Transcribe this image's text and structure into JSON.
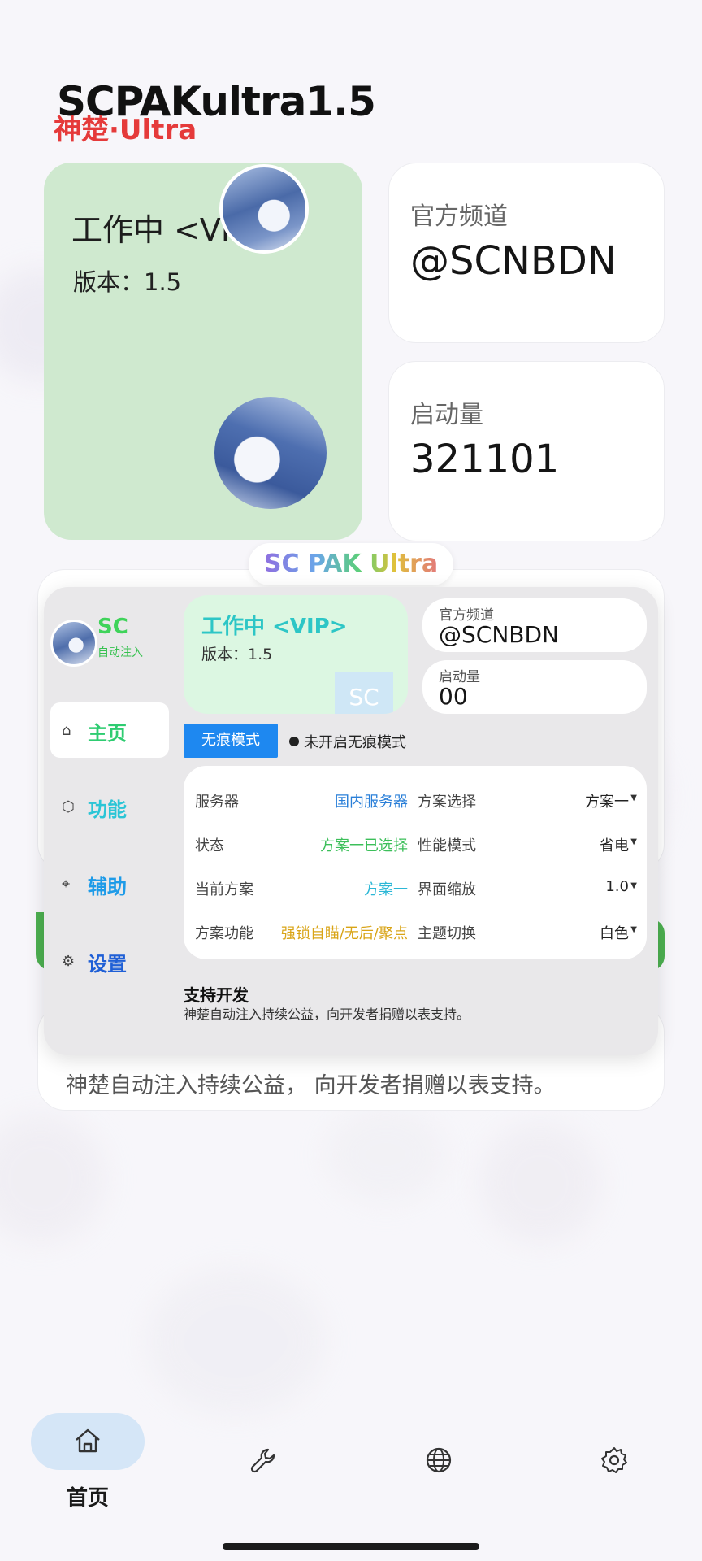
{
  "header": {
    "title": "SCPAKultra1.5",
    "subtitle": "神楚·Ultra"
  },
  "status_card": {
    "title": "工作中 <VIP>",
    "version": "版本：1.5"
  },
  "channel_card": {
    "label": "官方频道",
    "value": "@SCNBDN"
  },
  "launch_card": {
    "label": "启动量",
    "value": "321101"
  },
  "brand_pill": {
    "text": "SC PAK Ultra"
  },
  "support_card": {
    "text": "神楚自动注入持续公益， 向开发者捐赠以表支持。"
  },
  "overlay": {
    "brand": "SC",
    "brand_sub": "自动注入",
    "nav": [
      {
        "label": "主页",
        "icon": "home-icon",
        "color": "#2ecc71"
      },
      {
        "label": "功能",
        "icon": "cube-icon",
        "color": "#2bc5d6"
      },
      {
        "label": "辅助",
        "icon": "crosshair-icon",
        "color": "#1e9be8"
      },
      {
        "label": "设置",
        "icon": "gear-icon",
        "color": "#1f5fd6"
      }
    ],
    "status": {
      "title": "工作中 <VIP>",
      "version": "版本：1.5",
      "badge": "SC"
    },
    "channel": {
      "label": "官方频道",
      "value": "@SCNBDN"
    },
    "launch": {
      "label": "启动量",
      "value": "00"
    },
    "trace_button": "无痕模式",
    "trace_status": "未开启无痕模式",
    "settings": [
      {
        "k1": "服务器",
        "v1": "国内服务器",
        "v1_color": "#2a7fd8",
        "k2": "方案选择",
        "v2": "方案一"
      },
      {
        "k1": "状态",
        "v1": "方案一已选择",
        "v1_color": "#3cbf5a",
        "k2": "性能模式",
        "v2": "省电"
      },
      {
        "k1": "当前方案",
        "v1": "方案一",
        "v1_color": "#2bb7d6",
        "k2": "界面缩放",
        "v2": "1.0"
      },
      {
        "k1": "方案功能",
        "v1": "强锁自瞄/无后/聚点",
        "v1_color": "#d9a417",
        "k2": "主题切换",
        "v2": "白色"
      }
    ],
    "support_title": "支持开发",
    "support_text": "神楚自动注入持续公益，向开发者捐赠以表支持。"
  },
  "bottom_nav": [
    {
      "label": "首页",
      "icon": "home-icon",
      "active": true
    },
    {
      "label": "",
      "icon": "wrench-icon",
      "active": false
    },
    {
      "label": "",
      "icon": "globe-icon",
      "active": false
    },
    {
      "label": "",
      "icon": "gear-icon",
      "active": false
    }
  ],
  "colors": {
    "accent_red": "#e53a3a",
    "status_green_bg": "#cfe9cf",
    "nav_active_bg": "#d5e6f7",
    "trace_button_blue": "#1e88f0"
  }
}
